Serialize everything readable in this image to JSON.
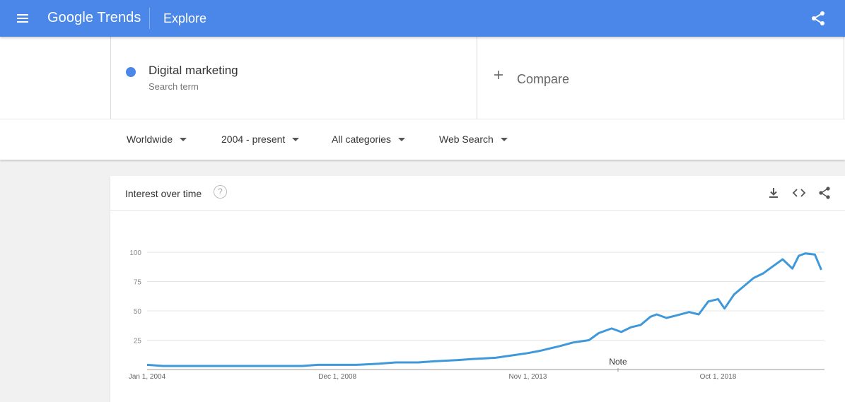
{
  "header": {
    "logo": "Google Trends",
    "section": "Explore"
  },
  "search_term": {
    "name": "Digital marketing",
    "subtitle": "Search term",
    "color": "#4a87e9"
  },
  "compare": {
    "label": "Compare"
  },
  "filters": {
    "region": "Worldwide",
    "time_range": "2004 - present",
    "category": "All categories",
    "search_type": "Web Search"
  },
  "card": {
    "title": "Interest over time",
    "help_icon": "?",
    "icons": [
      "download-icon",
      "embed-icon",
      "share-icon"
    ]
  },
  "chart_data": {
    "type": "line",
    "series": [
      {
        "color": "#3e98da",
        "x": [
          "2004-01",
          "2004-06",
          "2005-01",
          "2005-06",
          "2006-01",
          "2006-06",
          "2007-01",
          "2007-06",
          "2008-01",
          "2008-06",
          "2008-12",
          "2009-06",
          "2010-01",
          "2010-06",
          "2011-01",
          "2011-06",
          "2012-01",
          "2012-06",
          "2013-01",
          "2013-06",
          "2013-11",
          "2014-03",
          "2014-06",
          "2014-09",
          "2015-01",
          "2015-06",
          "2015-09",
          "2016-01",
          "2016-04",
          "2016-07",
          "2016-10",
          "2017-01",
          "2017-03",
          "2017-06",
          "2017-09",
          "2018-01",
          "2018-04",
          "2018-07",
          "2018-10",
          "2018-12",
          "2019-03",
          "2019-06",
          "2019-09",
          "2019-12",
          "2020-03",
          "2020-06",
          "2020-09",
          "2020-11",
          "2021-01",
          "2021-04",
          "2021-06"
        ],
        "values": [
          4,
          3,
          3,
          3,
          3,
          3,
          3,
          3,
          3,
          4,
          4,
          4,
          5,
          6,
          6,
          7,
          8,
          9,
          10,
          12,
          14,
          16,
          18,
          20,
          23,
          25,
          31,
          35,
          32,
          36,
          38,
          45,
          47,
          44,
          46,
          49,
          47,
          58,
          60,
          52,
          64,
          71,
          78,
          82,
          88,
          94,
          86,
          97,
          99,
          98,
          85
        ]
      }
    ],
    "x_tick_labels": [
      "Jan 1, 2004",
      "Dec 1, 2008",
      "Nov 1, 2013",
      "Oct 1, 2018"
    ],
    "y_ticks": [
      25,
      50,
      75,
      100
    ],
    "ylim": [
      0,
      100
    ],
    "annotations": [
      {
        "label": "Note",
        "x": "2016-03"
      }
    ],
    "grid": true
  }
}
